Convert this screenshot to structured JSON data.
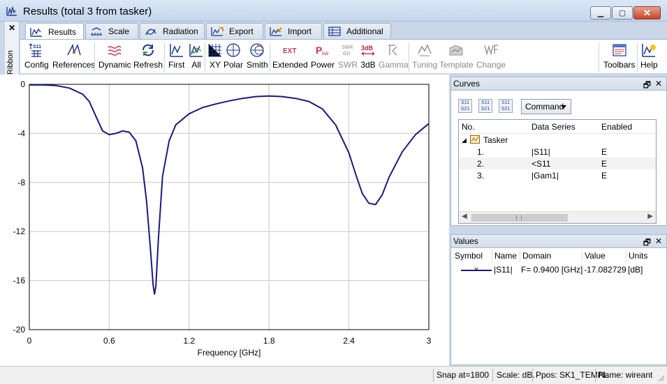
{
  "window": {
    "title": "Results (total 3 from tasker)"
  },
  "ribbon_side": {
    "close": "✕",
    "label": "Ribbon"
  },
  "tabs": [
    "Results",
    "Scale",
    "Radiation",
    "Export",
    "Import",
    "Additional"
  ],
  "toolbar": {
    "config": "Config",
    "references": "References",
    "dynamic": "Dynamic",
    "refresh": "Refresh",
    "first": "First",
    "all": "All",
    "xy": "XY",
    "polar": "Polar",
    "smith": "Smith",
    "extended": "Extended",
    "power": "Power",
    "swr": "SWR",
    "db3": "3dB",
    "gamma": "Gamma",
    "tuning": "Tuning",
    "template": "Template",
    "change": "Change",
    "toolbars": "Toolbars",
    "help": "Help",
    "icon_text": {
      "s11": "S11",
      "ext": "EXT",
      "pbal": "P",
      "pbal_sub": "bal",
      "swr_top": "SWR",
      "swr_bot": "GD",
      "db3": "3dB"
    }
  },
  "chart_data": {
    "type": "line",
    "title": "",
    "xlabel": "Frequency [GHz]",
    "ylabel": "",
    "xlim": [
      0,
      3
    ],
    "ylim": [
      -20,
      0
    ],
    "x_ticks": [
      "0",
      "0.6",
      "1.2",
      "1.8",
      "2.4",
      "3"
    ],
    "y_ticks": [
      "0",
      "-4",
      "-8",
      "-12",
      "-16",
      "-20"
    ],
    "grid": true,
    "series": [
      {
        "color": "#1a1a7a",
        "x": [
          0.1,
          0.2,
          0.3,
          0.4,
          0.45,
          0.5,
          0.55,
          0.6,
          0.65,
          0.7,
          0.75,
          0.8,
          0.85,
          0.88,
          0.91,
          0.93,
          0.94,
          0.95,
          0.97,
          1.0,
          1.05,
          1.1,
          1.2,
          1.3,
          1.4,
          1.5,
          1.6,
          1.7,
          1.8,
          1.9,
          2.0,
          2.1,
          2.2,
          2.3,
          2.4,
          2.45,
          2.5,
          2.55,
          2.6,
          2.65,
          2.7,
          2.8,
          2.9,
          3.0
        ],
        "y": [
          -0.05,
          -0.1,
          -0.3,
          -0.8,
          -1.4,
          -2.6,
          -3.8,
          -4.1,
          -4.0,
          -3.8,
          -3.9,
          -4.6,
          -6.8,
          -9.5,
          -13.5,
          -16.4,
          -17.1,
          -16.5,
          -12.5,
          -7.5,
          -4.6,
          -3.3,
          -2.4,
          -1.9,
          -1.6,
          -1.35,
          -1.15,
          -1.0,
          -0.95,
          -1.0,
          -1.15,
          -1.4,
          -2.0,
          -3.3,
          -5.6,
          -7.3,
          -8.9,
          -9.7,
          -9.8,
          -9.0,
          -7.6,
          -5.5,
          -4.1,
          -3.2
        ]
      }
    ]
  },
  "curves": {
    "title": "Curves",
    "command_label": "Command",
    "icons": [
      {
        "name": "s11-s21-a-icon",
        "top": "S11",
        "bottom": "S21"
      },
      {
        "name": "s11-s21-b-icon",
        "top": "S11",
        "bottom": "S21"
      },
      {
        "name": "s11-s21-c-icon",
        "top": "S11",
        "bottom": "S21"
      }
    ],
    "columns": [
      "No.",
      "Data Series",
      "Enabled"
    ],
    "group": "Tasker",
    "rows": [
      {
        "no": "1.",
        "series": "|S11|",
        "enabled": "E"
      },
      {
        "no": "2.",
        "series": "<S11",
        "enabled": "E"
      },
      {
        "no": "3.",
        "series": "|Gam1|",
        "enabled": "E"
      }
    ]
  },
  "values": {
    "title": "Values",
    "columns": [
      "Symbol",
      "Name",
      "Domain",
      "Value",
      "Units"
    ],
    "row": {
      "name": "|S11|",
      "domain": "F=  0.9400 [GHz]",
      "value": "-17.082729",
      "units": "[dB]"
    }
  },
  "status": {
    "snap": "Snap at=1800",
    "scale": "Scale: dB.",
    "ppos": "Ppos: SK1_TEMPL",
    "name": "Name: wireant"
  }
}
